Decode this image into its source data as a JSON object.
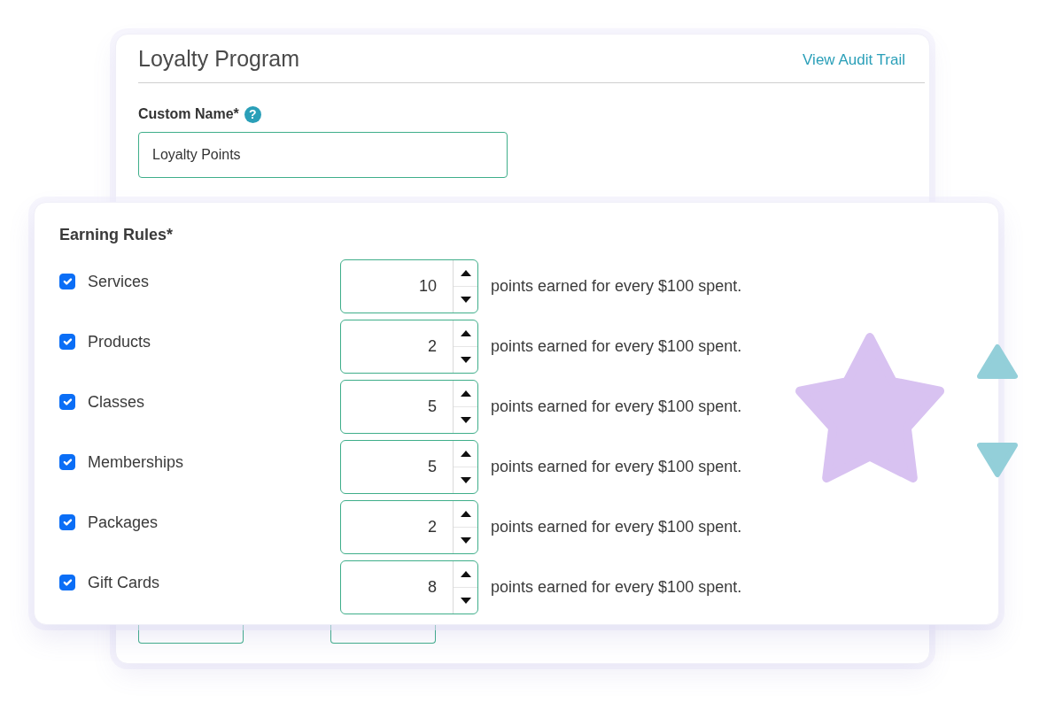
{
  "program_card": {
    "title": "Loyalty Program",
    "audit_link": "View Audit Trail",
    "custom_name": {
      "label": "Custom Name*",
      "help": "?",
      "value": "Loyalty Points"
    }
  },
  "earning_rules": {
    "title": "Earning Rules*",
    "rules": [
      {
        "label": "Services",
        "checked": true,
        "value": "10",
        "suffix": "points earned for every $100 spent."
      },
      {
        "label": "Products",
        "checked": true,
        "value": "2",
        "suffix": "points earned for every $100 spent."
      },
      {
        "label": "Classes",
        "checked": true,
        "value": "5",
        "suffix": "points earned for every $100 spent."
      },
      {
        "label": "Memberships",
        "checked": true,
        "value": "5",
        "suffix": "points earned for every $100 spent."
      },
      {
        "label": "Packages",
        "checked": true,
        "value": "2",
        "suffix": "points earned for every $100 spent."
      },
      {
        "label": "Gift Cards",
        "checked": true,
        "value": "8",
        "suffix": "points earned for every $100 spent."
      }
    ]
  }
}
